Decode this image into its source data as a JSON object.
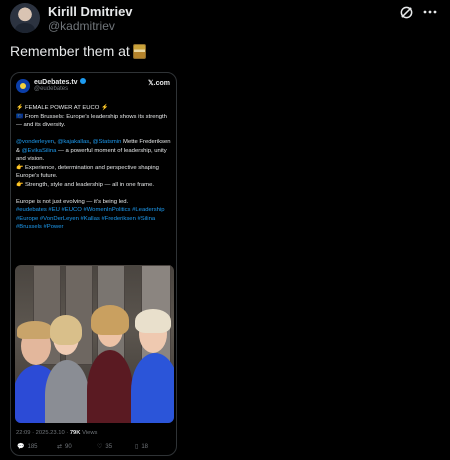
{
  "author": {
    "display_name": "Kirill Dmitriev",
    "handle": "@kadmitriev"
  },
  "tweet": {
    "text": "Remember them at",
    "emoji_icon": "hotel-emoji-icon"
  },
  "header_icons": [
    "grok-icon",
    "more-icon"
  ],
  "embed": {
    "name": "euDebates.tv",
    "handle": "@eudebates",
    "source": "𝕏.com",
    "lines": [
      "⚡ FEMALE POWER AT EUCO ⚡",
      "🇪🇺 From Brussels: Europe’s leadership shows its strength — and its diversity.",
      "",
      "@vonderleyen, @kajakallas, @Statsmin Mette Frederiksen & @EvikaSilina — a powerful moment of leadership, unity and vision.",
      "👉 Experience, determination and perspective shaping Europe’s future.",
      "👉 Strength, style and leadership — all in one frame.",
      "",
      "Europe is not just evolving — it’s being led.",
      "#eudebates #EU #EUCO #WomenInPolitics #Leadership #Europe #VonDerLeyen #Kallas #Frederiksen #Silina #Brussels #Power"
    ],
    "timestamp": "22:09 · 2025.23.10",
    "views_count": "79K",
    "views_label": "Views",
    "actions": {
      "replies": "185",
      "reposts": "90",
      "likes": "35",
      "bookmarks": "18"
    }
  }
}
